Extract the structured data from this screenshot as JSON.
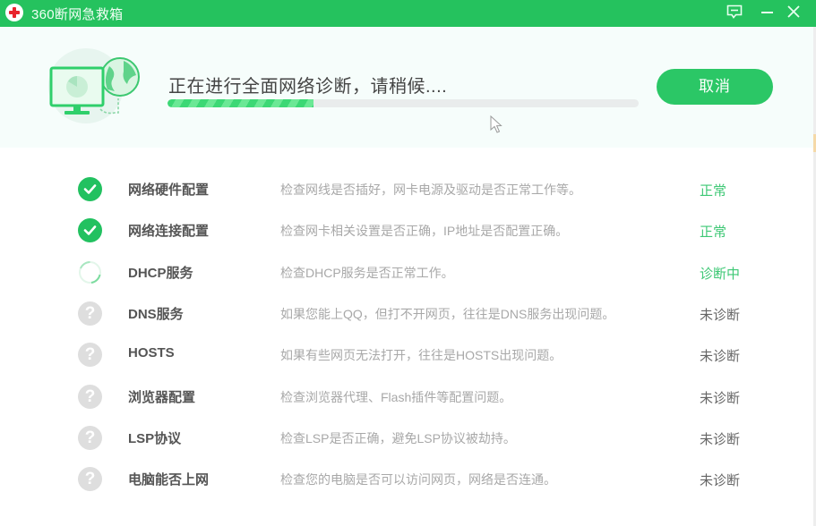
{
  "window": {
    "title": "360断网急救箱",
    "controls": {
      "feedback": "feedback-icon",
      "minimize": "minimize-icon",
      "close": "close-icon"
    }
  },
  "header": {
    "status_text": "正在进行全面网络诊断，请稍候....",
    "progress_percent": 31,
    "cancel_label": "取消"
  },
  "colors": {
    "brand_green": "#25c25e",
    "button_green": "#2bc766",
    "status_ok": "#3ec875",
    "status_pending": "#666666",
    "description_gray": "#a8a8a8"
  },
  "items": [
    {
      "name": "网络硬件配置",
      "description": "检查网线是否插好，网卡电源及驱动是否正常工作等。",
      "status": "正常",
      "state": "ok",
      "icon": "check-circle-icon"
    },
    {
      "name": "网络连接配置",
      "description": "检查网卡相关设置是否正确，IP地址是否配置正确。",
      "status": "正常",
      "state": "ok",
      "icon": "check-circle-icon"
    },
    {
      "name": "DHCP服务",
      "description": "检查DHCP服务是否正常工作。",
      "status": "诊断中",
      "state": "running",
      "icon": "loading-spinner-icon"
    },
    {
      "name": "DNS服务",
      "description": "如果您能上QQ，但打不开网页，往往是DNS服务出现问题。",
      "status": "未诊断",
      "state": "pending",
      "icon": "question-circle-icon"
    },
    {
      "name": "HOSTS",
      "description": "如果有些网页无法打开，往往是HOSTS出现问题。",
      "status": "未诊断",
      "state": "pending",
      "icon": "question-circle-icon"
    },
    {
      "name": "浏览器配置",
      "description": "检查浏览器代理、Flash插件等配置问题。",
      "status": "未诊断",
      "state": "pending",
      "icon": "question-circle-icon"
    },
    {
      "name": "LSP协议",
      "description": "检查LSP是否正确，避免LSP协议被劫持。",
      "status": "未诊断",
      "state": "pending",
      "icon": "question-circle-icon"
    },
    {
      "name": "电脑能否上网",
      "description": "检查您的电脑是否可以访问网页，网络是否连通。",
      "status": "未诊断",
      "state": "pending",
      "icon": "question-circle-icon"
    }
  ]
}
